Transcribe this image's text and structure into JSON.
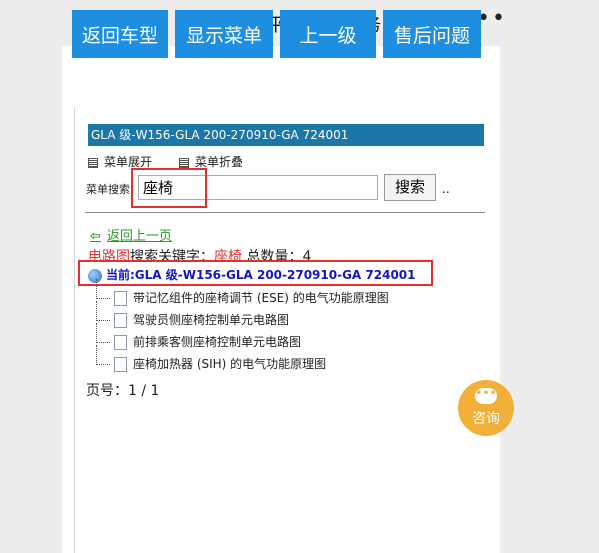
{
  "header": {
    "close_label": "✕",
    "title": "畅易汽车维平台-专业服务15年",
    "more_label": "•••"
  },
  "nav": [
    {
      "label": "返回车型"
    },
    {
      "label": "显示菜单"
    },
    {
      "label": "上一级"
    },
    {
      "label": "售后问题"
    }
  ],
  "crumb": "GLA 级-W156-GLA 200-270910-GA 724001",
  "menu": {
    "expand": "菜单展开",
    "collapse": "菜单折叠"
  },
  "search": {
    "label": "菜单搜索",
    "value": "座椅",
    "button": "搜索",
    "dots": ".."
  },
  "back_link": "返回上一页",
  "result": {
    "category": "电路图",
    "text": "搜索关键字：",
    "keyword": "座椅",
    "count_label": " 总数量：4"
  },
  "current": "当前:GLA 级-W156-GLA 200-270910-GA 724001",
  "items": [
    "带记忆组件的座椅调节 (ESE) 的电气功能原理图",
    "驾驶员侧座椅控制单元电路图",
    "前排乘客侧座椅控制单元电路图",
    "座椅加热器 (SIH) 的电气功能原理图"
  ],
  "pagination": "页号：1 / 1",
  "consult_label": "咨询",
  "colors": {
    "nav_bg": "#1e8ee0",
    "crumb_bg": "#1a77a8",
    "highlight": "#e03030",
    "consult": "#f2b03b"
  }
}
